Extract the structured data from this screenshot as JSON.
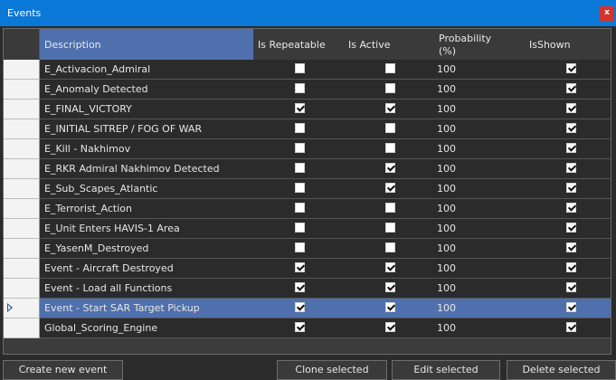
{
  "window": {
    "title": "Events",
    "close_label": "x"
  },
  "grid": {
    "columns": {
      "description": "Description",
      "is_repeatable": "Is Repeatable",
      "is_active": "Is Active",
      "probability_line1": "Probability",
      "probability_line2": "(%)",
      "is_shown": "IsShown"
    },
    "rows": [
      {
        "description": "E_Activacion_Admiral",
        "is_repeatable": false,
        "is_active": false,
        "probability": "100",
        "is_shown": true
      },
      {
        "description": "E_Anomaly Detected",
        "is_repeatable": false,
        "is_active": false,
        "probability": "100",
        "is_shown": true
      },
      {
        "description": "E_FINAL_VICTORY",
        "is_repeatable": true,
        "is_active": true,
        "probability": "100",
        "is_shown": true
      },
      {
        "description": "E_INITIAL SITREP / FOG OF WAR",
        "is_repeatable": false,
        "is_active": false,
        "probability": "100",
        "is_shown": true
      },
      {
        "description": "E_Kill - Nakhimov",
        "is_repeatable": false,
        "is_active": false,
        "probability": "100",
        "is_shown": true
      },
      {
        "description": "E_RKR Admiral Nakhimov Detected",
        "is_repeatable": false,
        "is_active": true,
        "probability": "100",
        "is_shown": true
      },
      {
        "description": "E_Sub_Scapes_Atlantic",
        "is_repeatable": false,
        "is_active": true,
        "probability": "100",
        "is_shown": true
      },
      {
        "description": "E_Terrorist_Action",
        "is_repeatable": false,
        "is_active": false,
        "probability": "100",
        "is_shown": true
      },
      {
        "description": "E_Unit Enters HAVIS-1 Area",
        "is_repeatable": false,
        "is_active": false,
        "probability": "100",
        "is_shown": true
      },
      {
        "description": "E_YasenM_Destroyed",
        "is_repeatable": false,
        "is_active": false,
        "probability": "100",
        "is_shown": true
      },
      {
        "description": "Event - Aircraft Destroyed",
        "is_repeatable": true,
        "is_active": true,
        "probability": "100",
        "is_shown": true
      },
      {
        "description": "Event - Load all Functions",
        "is_repeatable": true,
        "is_active": true,
        "probability": "100",
        "is_shown": true
      },
      {
        "description": "Event - Start SAR Target Pickup",
        "is_repeatable": true,
        "is_active": true,
        "probability": "100",
        "is_shown": true,
        "selected": true
      },
      {
        "description": "Global_Scoring_Engine",
        "is_repeatable": true,
        "is_active": true,
        "probability": "100",
        "is_shown": true
      }
    ]
  },
  "buttons": {
    "create": "Create new event",
    "clone": "Clone selected",
    "edit": "Edit selected",
    "delete": "Delete selected"
  },
  "colors": {
    "title_bar": "#0a78d7",
    "close_button": "#d9322b",
    "selection": "#4f70ad",
    "background": "#2b2b2b"
  }
}
